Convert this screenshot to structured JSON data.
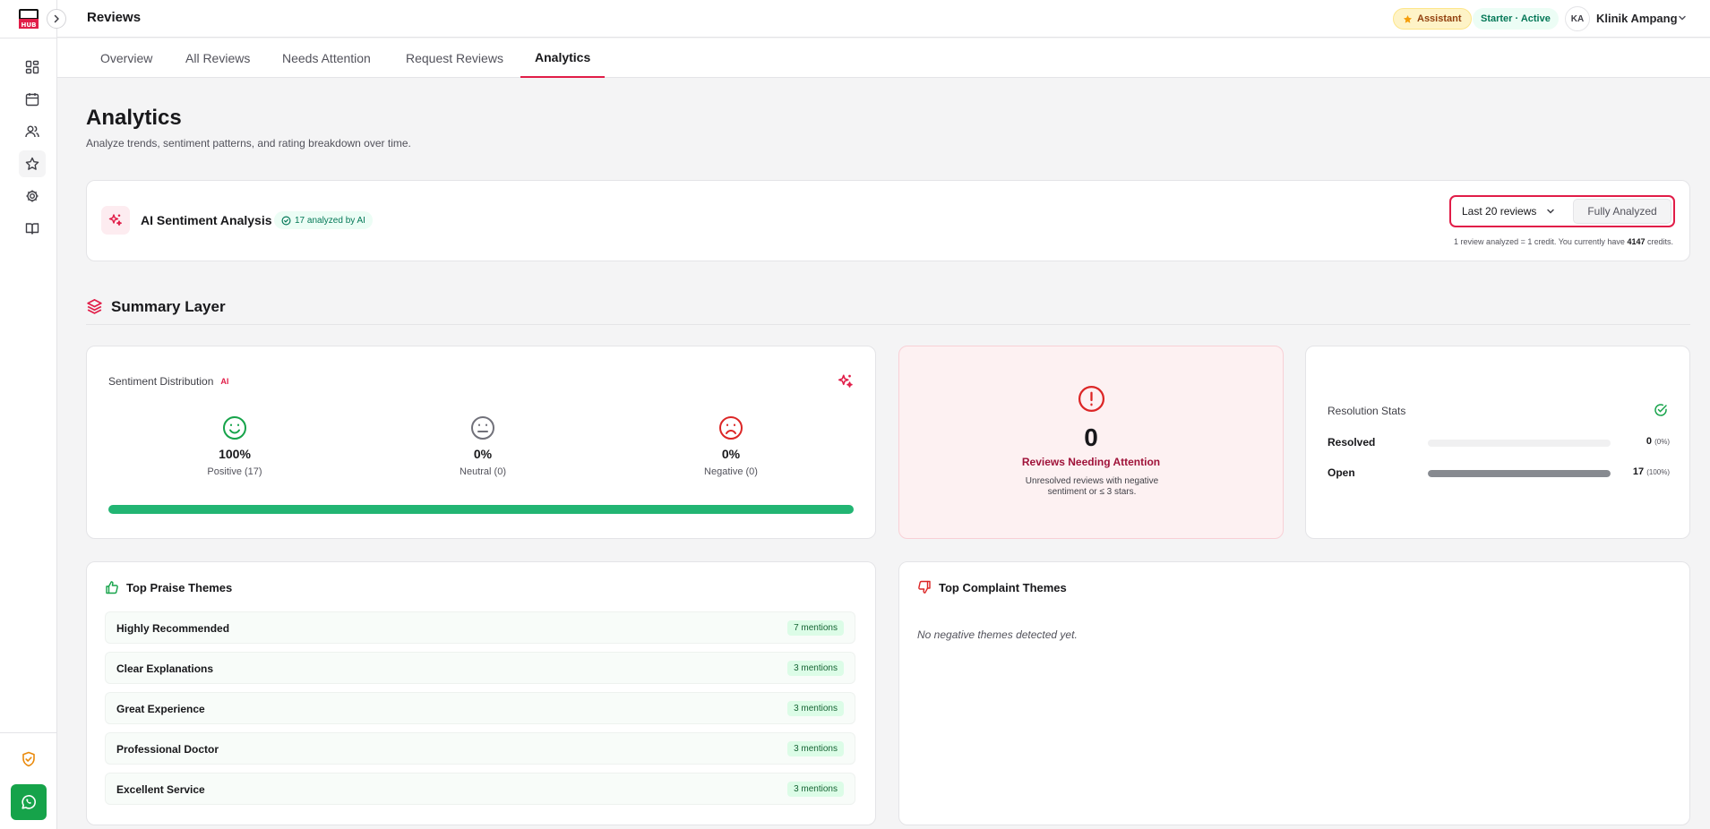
{
  "sidebar": {
    "logo_text": "HUB",
    "nav": [
      {
        "icon": "dashboard-icon"
      },
      {
        "icon": "calendar-icon"
      },
      {
        "icon": "users-icon"
      },
      {
        "icon": "star-icon"
      },
      {
        "icon": "gear-icon"
      },
      {
        "icon": "book-icon"
      }
    ]
  },
  "header": {
    "title": "Reviews",
    "assistant_label": "Assistant",
    "plan_status": "Starter · Active",
    "avatar_initials": "KA",
    "clinic_name": "Klinik Ampang"
  },
  "tabs": [
    {
      "label": "Overview",
      "active": false
    },
    {
      "label": "All Reviews",
      "active": false
    },
    {
      "label": "Needs Attention",
      "active": false
    },
    {
      "label": "Request Reviews",
      "active": false
    },
    {
      "label": "Analytics",
      "active": true
    }
  ],
  "page": {
    "title": "Analytics",
    "subtitle": "Analyze trends, sentiment patterns, and rating breakdown over time."
  },
  "ai_panel": {
    "title": "AI Sentiment Analysis",
    "badge": "17 analyzed by AI",
    "range_selected": "Last 20 reviews",
    "action_label": "Fully Analyzed",
    "credit_note_prefix": "1 review analyzed = 1 credit. You currently have",
    "credits": "4147",
    "credit_note_suffix": "credits."
  },
  "summary": {
    "title": "Summary Layer"
  },
  "sentiment": {
    "title": "Sentiment Distribution",
    "ai_tag": "AI",
    "positive": {
      "pct": "100%",
      "label": "Positive (17)"
    },
    "neutral": {
      "pct": "0%",
      "label": "Neutral (0)"
    },
    "negative": {
      "pct": "0%",
      "label": "Negative (0)"
    },
    "positive_fraction": 1.0
  },
  "attention": {
    "count": "0",
    "label": "Reviews Needing Attention",
    "description": "Unresolved reviews with negative sentiment or ≤ 3 stars."
  },
  "resolution": {
    "title": "Resolution Stats",
    "rows": [
      {
        "name": "Resolved",
        "count": "0",
        "pct": "(0%)",
        "fraction": 0.0
      },
      {
        "name": "Open",
        "count": "17",
        "pct": "(100%)",
        "fraction": 1.0
      }
    ]
  },
  "praise": {
    "title": "Top Praise Themes",
    "items": [
      {
        "name": "Highly Recommended",
        "mentions": "7 mentions"
      },
      {
        "name": "Clear Explanations",
        "mentions": "3 mentions"
      },
      {
        "name": "Great Experience",
        "mentions": "3 mentions"
      },
      {
        "name": "Professional Doctor",
        "mentions": "3 mentions"
      },
      {
        "name": "Excellent Service",
        "mentions": "3 mentions"
      }
    ]
  },
  "complaints": {
    "title": "Top Complaint Themes",
    "empty_text": "No negative themes detected yet."
  },
  "colors": {
    "accent": "#e11d48",
    "positive": "#22b573",
    "neutral": "#71717a",
    "negative": "#dc2626",
    "whatsapp": "#16a34a"
  }
}
